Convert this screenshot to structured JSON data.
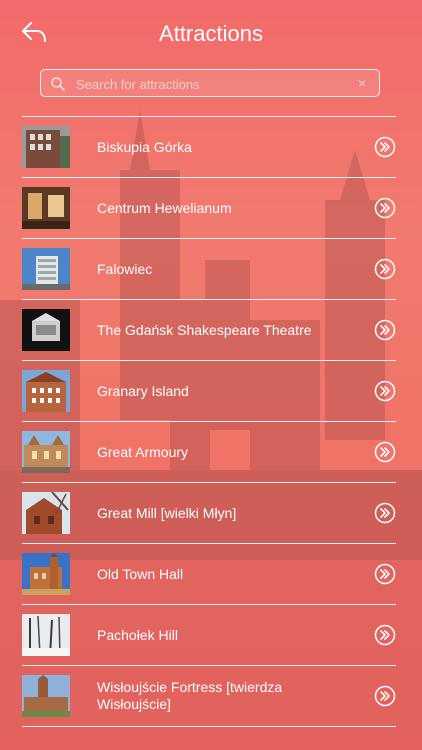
{
  "header": {
    "title": "Attractions",
    "back_icon": "back-arrow-icon"
  },
  "search": {
    "placeholder": "Search for attractions",
    "value": "",
    "icon": "search-icon",
    "clear_icon": "clear-icon",
    "clear_glyph": "×"
  },
  "colors": {
    "background_top": "#f26a6a",
    "background_bottom": "#ee6a66",
    "text": "#ffffff",
    "divider": "#ffffff"
  },
  "attractions": [
    {
      "label": "Biskupia Górka",
      "thumb": "brick-building"
    },
    {
      "label": "Centrum Hewelianum",
      "thumb": "interior-gallery"
    },
    {
      "label": "Falowiec",
      "thumb": "modern-block"
    },
    {
      "label": "The Gdańsk Shakespeare Theatre",
      "thumb": "theatre-model"
    },
    {
      "label": "Granary Island",
      "thumb": "granary"
    },
    {
      "label": "Great Armoury",
      "thumb": "armoury"
    },
    {
      "label": "Great Mill [wielki Młyn]",
      "thumb": "mill"
    },
    {
      "label": "Old Town Hall",
      "thumb": "town-hall"
    },
    {
      "label": "Pachołek Hill",
      "thumb": "winter-trees"
    },
    {
      "label": "Wisłoujście Fortress [twierdza Wisłoujście]",
      "thumb": "fortress"
    }
  ]
}
